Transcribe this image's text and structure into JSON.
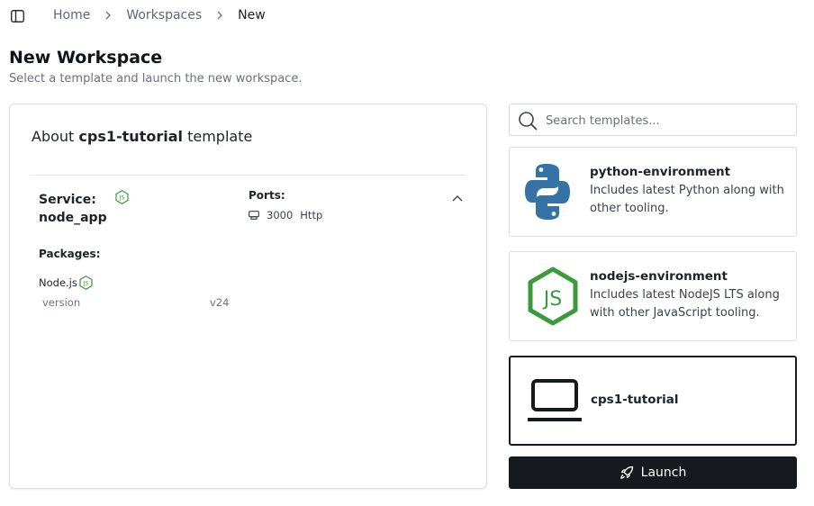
{
  "breadcrumb": {
    "items": [
      "Home",
      "Workspaces",
      "New"
    ]
  },
  "page": {
    "title": "New Workspace",
    "subtitle": "Select a template and launch the new workspace."
  },
  "about": {
    "prefix": "About",
    "template_name": "cps1-tutorial",
    "suffix": "template",
    "service": {
      "label": "Service:",
      "name": "node_app",
      "icon": "nodejs-icon"
    },
    "ports": {
      "label": "Ports:",
      "items": [
        {
          "number": "3000",
          "protocol": "Http",
          "icon": "port-icon"
        }
      ]
    },
    "packages": {
      "label": "Packages:",
      "items": [
        {
          "name": "Node.js",
          "icon": "nodejs-icon",
          "version_label": "version",
          "version_value": "v24"
        }
      ]
    }
  },
  "search": {
    "placeholder": "Search templates...",
    "value": ""
  },
  "templates": [
    {
      "name": "python-environment",
      "description": "Includes latest Python along with other tooling.",
      "icon": "python-logo-icon",
      "selected": false
    },
    {
      "name": "nodejs-environment",
      "description": "Includes latest NodeJS LTS along with other JavaScript tooling.",
      "icon": "nodejs-logo-icon",
      "selected": false
    },
    {
      "name": "cps1-tutorial",
      "description": "",
      "icon": "laptop-icon",
      "selected": true
    }
  ],
  "launch": {
    "label": "Launch",
    "icon": "rocket-icon"
  },
  "colors": {
    "node_green": "#3c9a3d",
    "python_blue": "#3572a5",
    "python_yellow": "#ffd43b",
    "primary_dark": "#16191d"
  }
}
